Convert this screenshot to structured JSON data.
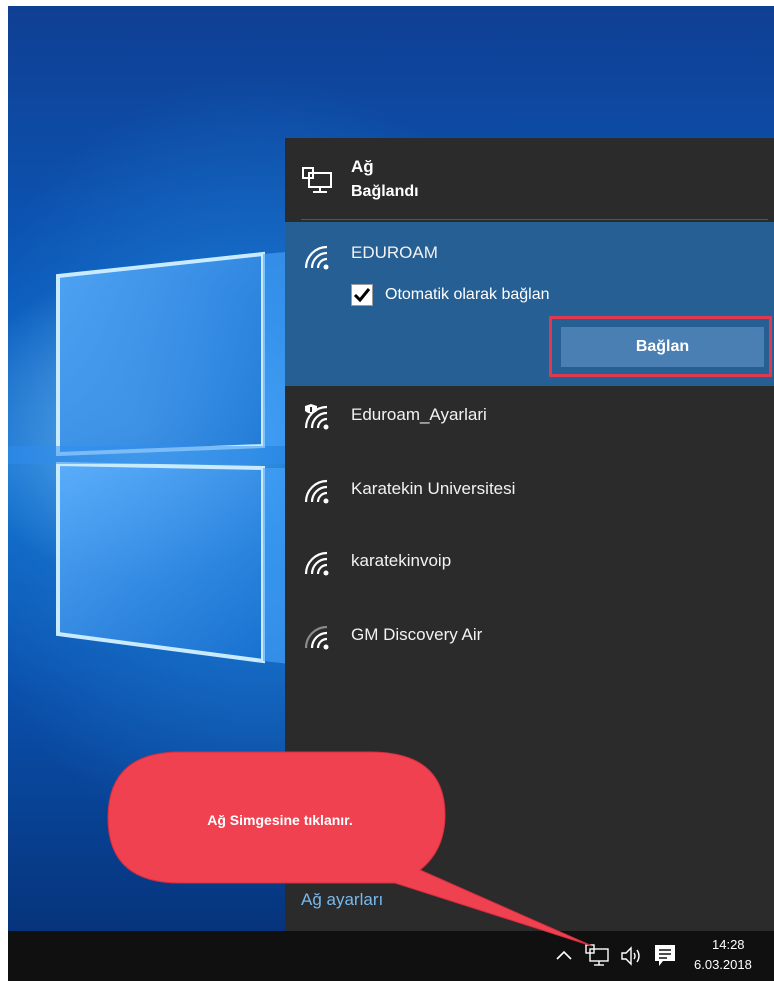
{
  "flyout": {
    "header": {
      "title": "Ağ",
      "status": "Bağlandı",
      "icon": "network-monitor-icon"
    },
    "selected_network": {
      "name": "EDUROAM",
      "auto_connect_label": "Otomatik olarak bağlan",
      "auto_connect_checked": true,
      "connect_button_label": "Bağlan",
      "icon": "wifi-icon"
    },
    "networks": [
      {
        "name": "Eduroam_Ayarlari",
        "icon": "wifi-secured-icon"
      },
      {
        "name": "Karatekin Universitesi",
        "icon": "wifi-icon"
      },
      {
        "name": "karatekinvoip",
        "icon": "wifi-icon"
      },
      {
        "name": "GM Discovery Air",
        "icon": "wifi-weak-icon"
      }
    ],
    "settings_link": "Ağ ayarları"
  },
  "taskbar": {
    "time": "14:28",
    "date": "6.03.2018",
    "icons": [
      "chevron-up-icon",
      "network-icon",
      "volume-icon",
      "action-center-icon"
    ]
  },
  "callout": {
    "text": "Ağ Simgesine tıklanır.",
    "color": "#f04150"
  },
  "colors": {
    "flyout_bg": "#2b2b2b",
    "selected_bg": "#265f94",
    "button_bg": "#4a7fb4",
    "highlight": "#e0394f",
    "link": "#76b9ed"
  }
}
